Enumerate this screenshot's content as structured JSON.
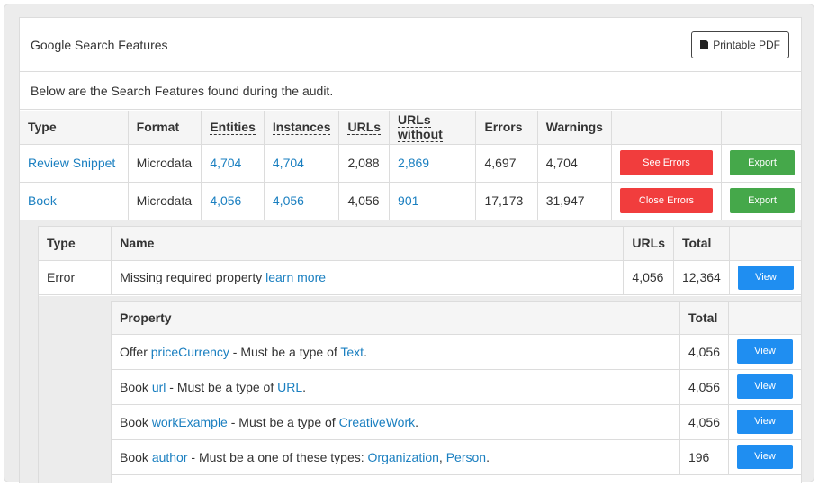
{
  "panel": {
    "title": "Google Search Features",
    "pdf_button": "Printable PDF",
    "intro": "Below are the Search Features found during the audit."
  },
  "main_table": {
    "headers": [
      "Type",
      "Format",
      "Entities",
      "Instances",
      "URLs",
      "URLs without",
      "Errors",
      "Warnings"
    ],
    "rows": [
      {
        "type": "Review Snippet",
        "format": "Microdata",
        "entities": "4,704",
        "instances": "4,704",
        "urls": "2,088",
        "urls_without": "2,869",
        "errors": "4,697",
        "warnings": "4,704",
        "error_button": "See Errors",
        "export_button": "Export"
      },
      {
        "type": "Book",
        "format": "Microdata",
        "entities": "4,056",
        "instances": "4,056",
        "urls": "4,056",
        "urls_without": "901",
        "errors": "17,173",
        "warnings": "31,947",
        "error_button": "Close Errors",
        "export_button": "Export"
      }
    ]
  },
  "errors_table": {
    "headers": [
      "Type",
      "Name",
      "URLs",
      "Total"
    ],
    "rows": [
      {
        "type": "Error",
        "name": "Missing required property",
        "link": "learn more",
        "urls": "4,056",
        "total": "12,364",
        "button": "View"
      }
    ]
  },
  "property_table": {
    "headers": [
      "Property",
      "Total"
    ],
    "rows": [
      {
        "prefix": "Offer",
        "prop": "priceCurrency",
        "mid": "- Must be a type of",
        "types": [
          "Text"
        ],
        "end": ".",
        "total": "4,056",
        "button": "View"
      },
      {
        "prefix": "Book",
        "prop": "url",
        "mid": "- Must be a type of",
        "types": [
          "URL"
        ],
        "end": ".",
        "total": "4,056",
        "button": "View"
      },
      {
        "prefix": "Book",
        "prop": "workExample",
        "mid": "- Must be a type of",
        "types": [
          "CreativeWork"
        ],
        "end": ".",
        "total": "4,056",
        "button": "View"
      },
      {
        "prefix": "Book",
        "prop": "author",
        "mid": "- Must be a one of these types:",
        "types": [
          "Organization",
          "Person"
        ],
        "end": ".",
        "total": "196",
        "button": "View"
      }
    ]
  },
  "colors": {
    "link": "#1a7fc0",
    "red_button": "#f13d3d",
    "green_button": "#45a84a",
    "blue_button": "#1f8ef1"
  }
}
